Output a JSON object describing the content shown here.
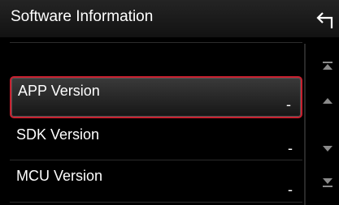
{
  "header": {
    "title": "Software Information",
    "back_icon": "back-arrow-icon"
  },
  "rows": [
    {
      "label": "APP Version",
      "value": "-",
      "selected": true
    },
    {
      "label": "SDK Version",
      "value": "-",
      "selected": false
    },
    {
      "label": "MCU Version",
      "value": "-",
      "selected": false
    }
  ],
  "scroll": {
    "icons": [
      "scroll-top-icon",
      "scroll-up-icon",
      "scroll-down-icon",
      "scroll-bottom-icon"
    ]
  },
  "colors": {
    "selection_border": "#c8202f",
    "background": "#000000",
    "text": "#ffffff",
    "icon": "#8a8a8a"
  }
}
